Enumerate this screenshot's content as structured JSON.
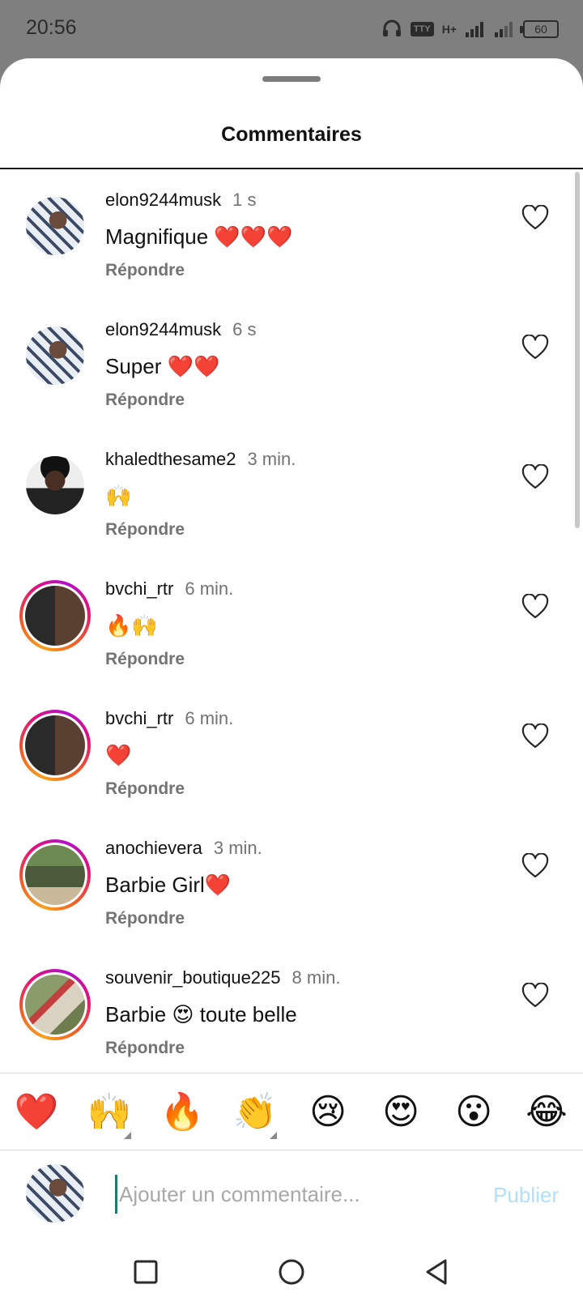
{
  "status_bar": {
    "time": "20:56",
    "tty": "TTY",
    "network": "H+",
    "battery": "60"
  },
  "sheet": {
    "title": "Commentaires"
  },
  "comments": [
    {
      "username": "elon9244musk",
      "time": "1 s",
      "text": "Magnifique ❤️❤️❤️",
      "reply": "Répondre",
      "avatar": "av-musk",
      "story_ring": false
    },
    {
      "username": "elon9244musk",
      "time": "6 s",
      "text": "Super ❤️❤️",
      "reply": "Répondre",
      "avatar": "av-musk",
      "story_ring": false
    },
    {
      "username": "khaledthesame2",
      "time": "3 min.",
      "text": "🙌",
      "reply": "Répondre",
      "avatar": "av-khaled",
      "story_ring": false
    },
    {
      "username": "bvchi_rtr",
      "time": "6 min.",
      "text": "🔥🙌",
      "reply": "Répondre",
      "avatar": "av-bvchi",
      "story_ring": true
    },
    {
      "username": "bvchi_rtr",
      "time": "6 min.",
      "text": "❤️",
      "reply": "Répondre",
      "avatar": "av-bvchi",
      "story_ring": true
    },
    {
      "username": "anochievera",
      "time": "3 min.",
      "text": "Barbie Girl❤️",
      "reply": "Répondre",
      "avatar": "av-ano",
      "story_ring": true
    },
    {
      "username": "souvenir_boutique225",
      "time": "8 min.",
      "text": "Barbie 😍 toute belle",
      "reply": "Répondre",
      "avatar": "av-souv",
      "story_ring": true
    }
  ],
  "reactions": [
    {
      "emoji": "❤️",
      "name": "heart",
      "has_variants": false
    },
    {
      "emoji": "🙌",
      "name": "raised-hands",
      "has_variants": true
    },
    {
      "emoji": "🔥",
      "name": "fire",
      "has_variants": false
    },
    {
      "emoji": "👏",
      "name": "clapping-hands",
      "has_variants": true
    },
    {
      "emoji": "😢",
      "name": "crying-face",
      "has_variants": false
    },
    {
      "emoji": "😍",
      "name": "heart-eyes",
      "has_variants": false
    },
    {
      "emoji": "😮",
      "name": "surprised-face",
      "has_variants": false
    },
    {
      "emoji": "😂",
      "name": "tears-of-joy",
      "has_variants": false
    }
  ],
  "composer": {
    "placeholder": "Ajouter un commentaire...",
    "value": "",
    "publish_label": "Publier"
  },
  "colors": {
    "accent_disabled": "#b2dffc",
    "secondary_text": "#737373",
    "story_ring": "#e2127a"
  }
}
